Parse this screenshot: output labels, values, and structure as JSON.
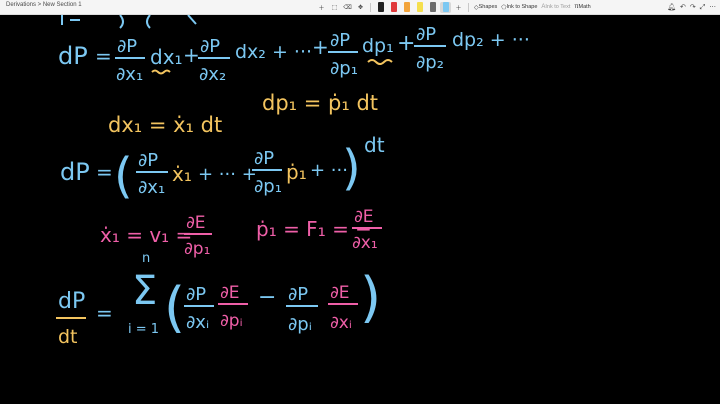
{
  "window": {
    "breadcrumb": "Derivations > New Section 1"
  },
  "toolbar": {
    "undo_icon": "lasso-icon",
    "tools": [
      {
        "name": "add-icon"
      },
      {
        "name": "eraser-icon"
      },
      {
        "name": "move-icon"
      }
    ],
    "pens": [
      {
        "name": "pen-black",
        "color": "#222222"
      },
      {
        "name": "pen-red",
        "color": "#e0393b"
      },
      {
        "name": "pen-orange",
        "color": "#f2a33a"
      },
      {
        "name": "pen-yellow",
        "color": "#f5df4d"
      },
      {
        "name": "pen-gray",
        "color": "#6d6d6d"
      },
      {
        "name": "pen-blue",
        "color": "#7cc8f2"
      }
    ],
    "shapes_label": "Shapes",
    "ink_to_shape_label": "Ink to Shape",
    "ink_to_text_label": "Ink to Text",
    "math_label": "Math",
    "right_icons": [
      "bell-icon",
      "undo-icon",
      "redo-icon",
      "expand-icon",
      "more-icon"
    ]
  },
  "ink": {
    "colors": {
      "blue": "#7cc8f2",
      "orange": "#f3c45f",
      "pink": "#ef5fa8",
      "canvas": "#000000"
    },
    "line1": {
      "lhs": "dP",
      "eq": "=",
      "t1_num": "∂P",
      "t1_den": "∂x₁",
      "t1_dx": "dx₁",
      "t2": "+",
      "t2_num": "∂P",
      "t2_den": "∂x₂",
      "t2_dx": "dx₂ + ···",
      "t3": "+",
      "t3_num": "∂P",
      "t3_den": "∂p₁",
      "t3_dp": "dp₁",
      "t4": "+",
      "t4_num": "∂P",
      "t4_den": "∂p₂",
      "t4_dp": "dp₂ + ···"
    },
    "line2": {
      "a": "dx₁ = ẋ₁ dt",
      "b": "dp₁ = ṗ₁ dt"
    },
    "line3": {
      "lhs": "dP",
      "eq": "=",
      "open": "(",
      "t1_num": "∂P",
      "t1_den": "∂x₁",
      "t1_dot": "ẋ₁",
      "mid": "+ ··· +",
      "t2_num": "∂P",
      "t2_den": "∂p₁",
      "t2_dot": "ṗ₁",
      "tail": "+ ···",
      "close": ")",
      "dt": "dt"
    },
    "line4": {
      "a_lhs": "ẋ₁ = v₁ =",
      "a_num": "∂E",
      "a_den": "∂p₁",
      "b_lhs": "ṗ₁ = F₁ = −",
      "b_num": "∂E",
      "b_den": "∂x₁"
    },
    "line5": {
      "lhs_num": "dP",
      "lhs_den": "dt",
      "eq": "=",
      "sum_top": "n",
      "sum": "Σ",
      "sum_bot": "i = 1",
      "open": "(",
      "f1_num": "∂P",
      "f1_den": "∂xᵢ",
      "f2_num": "∂E",
      "f2_den": "∂pᵢ",
      "minus": "−",
      "f3_num": "∂P",
      "f3_den": "∂pᵢ",
      "f4_num": "∂E",
      "f4_den": "∂xᵢ",
      "close": ")"
    }
  }
}
